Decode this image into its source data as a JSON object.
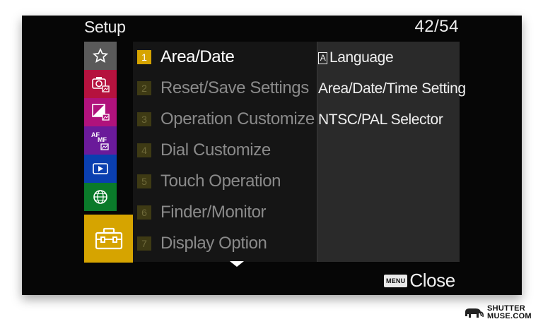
{
  "header": {
    "title": "Setup",
    "page_indicator": "42/54"
  },
  "tabs": [
    {
      "name": "my-menu",
      "icon": "star-icon",
      "color": "#5a5a5a"
    },
    {
      "name": "shooting-1",
      "icon": "camera-icon",
      "color": "#b5123e"
    },
    {
      "name": "exposure-color",
      "icon": "exposure-icon",
      "color": "#b0127c"
    },
    {
      "name": "focus",
      "icon": "af-mf-icon",
      "color": "#6a1a9a",
      "text": "AF MF"
    },
    {
      "name": "playback",
      "icon": "play-icon",
      "color": "#0a3fb0"
    },
    {
      "name": "network",
      "icon": "globe-icon",
      "color": "#0a7a2a"
    },
    {
      "name": "setup",
      "icon": "toolbox-icon",
      "color": "#d6a400",
      "selected": true
    }
  ],
  "menu": {
    "items": [
      {
        "number": "1",
        "label": "Area/Date",
        "selected": true
      },
      {
        "number": "2",
        "label": "Reset/Save Settings"
      },
      {
        "number": "3",
        "label": "Operation Customize"
      },
      {
        "number": "4",
        "label": "Dial Customize"
      },
      {
        "number": "5",
        "label": "Touch Operation"
      },
      {
        "number": "6",
        "label": "Finder/Monitor"
      },
      {
        "number": "7",
        "label": "Display Option"
      }
    ]
  },
  "submenu": {
    "items": [
      {
        "glyph": "A",
        "label": "Language"
      },
      {
        "label": "Area/Date/Time Setting"
      },
      {
        "label": "NTSC/PAL Selector"
      }
    ]
  },
  "footer": {
    "menu_key": "MENU",
    "close_label": "Close"
  },
  "watermark": {
    "line1": "SHUTTER",
    "line2": "MUSE.COM"
  }
}
